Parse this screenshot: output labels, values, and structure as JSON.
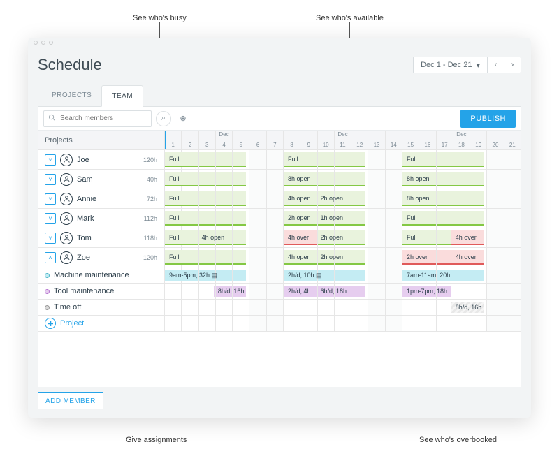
{
  "callouts": {
    "top_left": "See who's busy",
    "top_right": "See who's available",
    "bottom_left": "Give assignments",
    "bottom_right": "See who's overbooked"
  },
  "header": {
    "title": "Schedule",
    "date_range": "Dec 1 - Dec 21"
  },
  "tabs": {
    "projects": "PROJECTS",
    "team": "TEAM",
    "active": "team"
  },
  "toolbar": {
    "search_placeholder": "Search members",
    "publish": "PUBLISH"
  },
  "timeline": {
    "label": "Projects",
    "days": [
      {
        "n": "1",
        "m": ""
      },
      {
        "n": "2",
        "m": ""
      },
      {
        "n": "3",
        "m": ""
      },
      {
        "n": "4",
        "m": "Dec"
      },
      {
        "n": "5",
        "m": ""
      },
      {
        "n": "6",
        "we": true,
        "m": ""
      },
      {
        "n": "7",
        "we": true,
        "m": ""
      },
      {
        "n": "8",
        "m": ""
      },
      {
        "n": "9",
        "m": ""
      },
      {
        "n": "10",
        "m": ""
      },
      {
        "n": "11",
        "m": "Dec"
      },
      {
        "n": "12",
        "m": ""
      },
      {
        "n": "13",
        "we": true,
        "m": ""
      },
      {
        "n": "14",
        "we": true,
        "m": ""
      },
      {
        "n": "15",
        "m": ""
      },
      {
        "n": "16",
        "m": ""
      },
      {
        "n": "17",
        "m": ""
      },
      {
        "n": "18",
        "m": "Dec"
      },
      {
        "n": "19",
        "m": ""
      },
      {
        "n": "20",
        "we": true,
        "m": ""
      },
      {
        "n": "21",
        "we": true,
        "m": ""
      }
    ]
  },
  "people": [
    {
      "name": "Joe",
      "hours": "120h",
      "expand": "down",
      "weeks": [
        [
          {
            "label": "Full",
            "kind": "green",
            "start": 0,
            "span": 5
          }
        ],
        [
          {
            "label": "Full",
            "kind": "green",
            "start": 0,
            "span": 5
          }
        ],
        [
          {
            "label": "Full",
            "kind": "green",
            "start": 0,
            "span": 5
          }
        ]
      ]
    },
    {
      "name": "Sam",
      "hours": "40h",
      "expand": "down",
      "weeks": [
        [
          {
            "label": "Full",
            "kind": "green",
            "start": 0,
            "span": 5
          }
        ],
        [
          {
            "label": "8h open",
            "kind": "green",
            "start": 0,
            "span": 5
          }
        ],
        [
          {
            "label": "8h open",
            "kind": "green",
            "start": 0,
            "span": 5
          }
        ]
      ]
    },
    {
      "name": "Annie",
      "hours": "72h",
      "expand": "down",
      "weeks": [
        [
          {
            "label": "Full",
            "kind": "green",
            "start": 0,
            "span": 5
          }
        ],
        [
          {
            "label": "4h open",
            "kind": "green",
            "start": 0,
            "span": 2
          },
          {
            "label": "2h open",
            "kind": "green",
            "start": 2,
            "span": 3
          }
        ],
        [
          {
            "label": "8h open",
            "kind": "green",
            "start": 0,
            "span": 5
          }
        ]
      ]
    },
    {
      "name": "Mark",
      "hours": "112h",
      "expand": "down",
      "weeks": [
        [
          {
            "label": "Full",
            "kind": "green",
            "start": 0,
            "span": 5
          }
        ],
        [
          {
            "label": "2h open",
            "kind": "green",
            "start": 0,
            "span": 2
          },
          {
            "label": "1h open",
            "kind": "green",
            "start": 2,
            "span": 3
          }
        ],
        [
          {
            "label": "Full",
            "kind": "green",
            "start": 0,
            "span": 5
          }
        ]
      ]
    },
    {
      "name": "Tom",
      "hours": "118h",
      "expand": "down",
      "weeks": [
        [
          {
            "label": "Full",
            "kind": "green",
            "start": 0,
            "span": 2
          },
          {
            "label": "4h open",
            "kind": "green",
            "start": 2,
            "span": 3
          }
        ],
        [
          {
            "label": "4h over",
            "kind": "red",
            "start": 0,
            "span": 2
          },
          {
            "label": "2h open",
            "kind": "green",
            "start": 2,
            "span": 3
          }
        ],
        [
          {
            "label": "Full",
            "kind": "green",
            "start": 0,
            "span": 3
          },
          {
            "label": "4h over",
            "kind": "red",
            "start": 3,
            "span": 2
          }
        ]
      ]
    },
    {
      "name": "Zoe",
      "hours": "120h",
      "expand": "up",
      "weeks": [
        [
          {
            "label": "Full",
            "kind": "green",
            "start": 0,
            "span": 5
          }
        ],
        [
          {
            "label": "4h open",
            "kind": "green",
            "start": 0,
            "span": 2
          },
          {
            "label": "2h open",
            "kind": "green",
            "start": 2,
            "span": 3
          }
        ],
        [
          {
            "label": "2h over",
            "kind": "red",
            "start": 0,
            "span": 3
          },
          {
            "label": "4h over",
            "kind": "red",
            "start": 3,
            "span": 2
          }
        ]
      ]
    }
  ],
  "tasks": [
    {
      "name": "Machine maintenance",
      "dot": "teal",
      "weeks": [
        [
          {
            "label": "9am-5pm, 32h ▤",
            "kind": "teal",
            "start": 0,
            "span": 5
          }
        ],
        [
          {
            "label": "2h/d, 10h ▤",
            "kind": "teal",
            "start": 0,
            "span": 5
          }
        ],
        [
          {
            "label": "7am-11am, 20h",
            "kind": "teal",
            "start": 0,
            "span": 5
          }
        ]
      ]
    },
    {
      "name": "Tool maintenance",
      "dot": "purple",
      "weeks": [
        [
          {
            "label": "8h/d, 16h",
            "kind": "purple",
            "start": 3,
            "span": 2
          }
        ],
        [
          {
            "label": "2h/d, 4h",
            "kind": "purple",
            "start": 0,
            "span": 2
          },
          {
            "label": "6h/d, 18h",
            "kind": "purple",
            "start": 2,
            "span": 3
          }
        ],
        [
          {
            "label": "1pm-7pm, 18h",
            "kind": "purple",
            "start": 0,
            "span": 3
          }
        ]
      ]
    },
    {
      "name": "Time off",
      "dot": "gray",
      "weeks": [
        [],
        [],
        [
          {
            "label": "8h/d, 16h",
            "kind": "gray",
            "start": 3,
            "span": 2
          }
        ]
      ]
    }
  ],
  "project_add": "Project",
  "add_member": "ADD MEMBER"
}
